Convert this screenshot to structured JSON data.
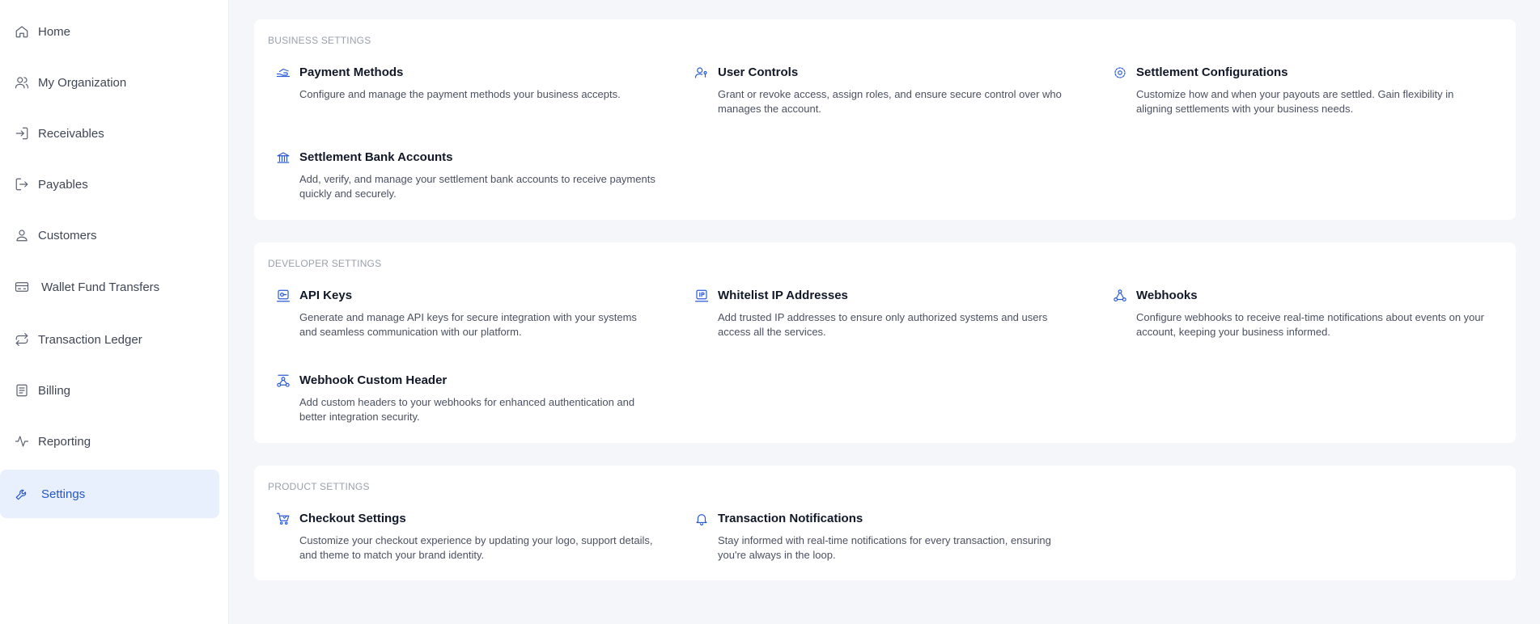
{
  "sidebar": {
    "items": [
      {
        "label": "Home",
        "icon": "home-icon"
      },
      {
        "label": "My Organization",
        "icon": "users-icon"
      },
      {
        "label": "Receivables",
        "icon": "login-arrow-icon"
      },
      {
        "label": "Payables",
        "icon": "logout-arrow-icon"
      },
      {
        "label": "Customers",
        "icon": "user-icon"
      },
      {
        "label": "Wallet Fund Transfers",
        "icon": "wallet-transfer-icon"
      },
      {
        "label": "Transaction Ledger",
        "icon": "exchange-arrows-icon"
      },
      {
        "label": "Billing",
        "icon": "receipt-icon"
      },
      {
        "label": "Reporting",
        "icon": "activity-icon"
      },
      {
        "label": "Settings",
        "icon": "wrench-icon"
      }
    ],
    "active": "Settings"
  },
  "sections": [
    {
      "title": "BUSINESS SETTINGS",
      "cards": [
        {
          "title": "Payment Methods",
          "desc": "Configure and manage the payment methods your business accepts.",
          "icon": "payment-hand-icon"
        },
        {
          "title": "User Controls",
          "desc": "Grant or revoke access, assign roles, and ensure secure control over who manages the account.",
          "icon": "user-key-icon"
        },
        {
          "title": "Settlement Configurations",
          "desc": "Customize how and when your payouts are settled. Gain flexibility in aligning settlements with your business needs.",
          "icon": "settings-cog-icon"
        },
        {
          "title": "Settlement Bank Accounts",
          "desc": "Add, verify, and manage your settlement bank accounts to receive payments quickly and securely.",
          "icon": "bank-icon"
        }
      ]
    },
    {
      "title": "DEVELOPER SETTINGS",
      "cards": [
        {
          "title": "API Keys",
          "desc": "Generate and manage API keys for secure integration with your systems and seamless communication with our platform.",
          "icon": "api-key-icon"
        },
        {
          "title": "Whitelist IP Addresses",
          "desc": "Add trusted IP addresses to ensure only authorized systems and users access all the services.",
          "icon": "ip-address-icon"
        },
        {
          "title": "Webhooks",
          "desc": "Configure webhooks to receive real-time notifications about events on your account, keeping your business informed.",
          "icon": "webhook-icon"
        },
        {
          "title": "Webhook Custom Header",
          "desc": "Add custom headers to your webhooks for enhanced authentication and better integration security.",
          "icon": "webhook-header-icon"
        }
      ]
    },
    {
      "title": "PRODUCT SETTINGS",
      "cards": [
        {
          "title": "Checkout Settings",
          "desc": "Customize your checkout experience by updating your logo, support details, and theme to match your brand identity.",
          "icon": "cart-icon"
        },
        {
          "title": "Transaction Notifications",
          "desc": "Stay informed with real-time notifications for every transaction, ensuring you're always in the loop.",
          "icon": "bell-icon"
        }
      ]
    }
  ],
  "colors": {
    "accent": "#2456c9",
    "active_bg": "#e8effd",
    "page_bg": "#f5f6fa"
  }
}
